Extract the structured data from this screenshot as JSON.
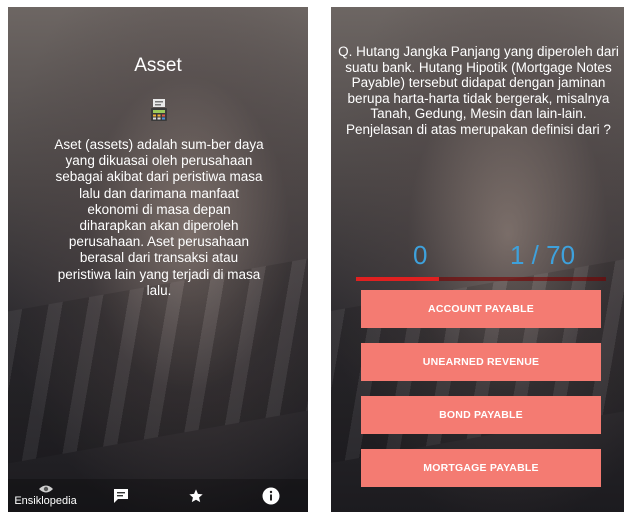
{
  "left_screen": {
    "title": "Asset",
    "icon": "calculator-icon",
    "body": "Aset (assets) adalah sum-ber daya yang dikuasai oleh perusahaan sebagai akibat dari peristiwa masa lalu dan darimana manfaat ekonomi di masa depan diharapkan akan diperoleh perusahaan. Aset perusahaan berasal dari transaksi atau peristiwa lain yang terjadi di masa lalu.",
    "bottom_nav": [
      {
        "label": "Ensiklopedia",
        "icon": "eye-icon"
      },
      {
        "label": "",
        "icon": "chat-icon"
      },
      {
        "label": "",
        "icon": "star-icon"
      },
      {
        "label": "",
        "icon": "info-icon"
      }
    ]
  },
  "right_screen": {
    "question": "Q. Hutang Jangka Panjang yang diperoleh dari suatu bank. Hutang Hipotik (Mortgage Notes Payable) tersebut didapat dengan jaminan berupa harta-harta tidak bergerak, misalnya Tanah, Gedung, Mesin dan lain-lain. Penjelasan di atas merupakan definisi dari ?",
    "score": "0",
    "counter": "1 / 70",
    "progress": 0.33,
    "answers": [
      "ACCOUNT PAYABLE",
      "UNEARNED REVENUE",
      "BOND PAYABLE",
      "MORTGAGE PAYABLE"
    ],
    "colors": {
      "accent": "#3ea1dc",
      "button": "#f47b72",
      "progress": "#e02020"
    }
  }
}
